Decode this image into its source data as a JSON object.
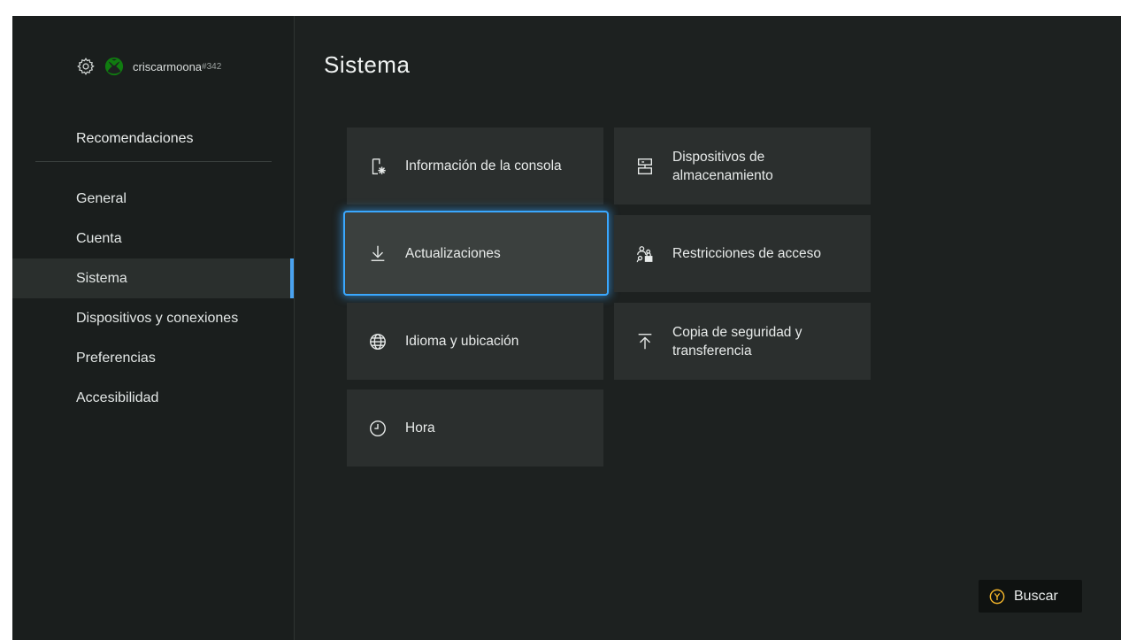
{
  "profile": {
    "gamertag": "criscarmoona",
    "gamertag_suffix": "#342",
    "icons": [
      "gear-icon",
      "xbox-logo-icon"
    ]
  },
  "sidebar": {
    "recommendations_label": "Recomendaciones",
    "items": [
      {
        "label": "General"
      },
      {
        "label": "Cuenta"
      },
      {
        "label": "Sistema",
        "selected": true
      },
      {
        "label": "Dispositivos y conexiones"
      },
      {
        "label": "Preferencias"
      },
      {
        "label": "Accesibilidad"
      }
    ]
  },
  "main": {
    "title": "Sistema",
    "tiles": [
      {
        "label": "Información de la consola",
        "icon": "console-info-icon"
      },
      {
        "label": "Dispositivos de almacenamiento",
        "icon": "storage-icon"
      },
      {
        "label": "Actualizaciones",
        "icon": "download-icon",
        "focused": true
      },
      {
        "label": "Restricciones de acceso",
        "icon": "access-restrictions-icon"
      },
      {
        "label": "Idioma y ubicación",
        "icon": "globe-icon"
      },
      {
        "label": "Copia de seguridad y transferencia",
        "icon": "upload-icon"
      },
      {
        "label": "Hora",
        "icon": "clock-icon"
      }
    ]
  },
  "footer": {
    "search_button": {
      "label": "Buscar",
      "hint": "Y",
      "icon": "y-button-icon"
    }
  },
  "colors": {
    "background": "#1d2120",
    "tile": "#2b2f2e",
    "focus_accent": "#3aa8ff",
    "selected_indicator": "#4aa3f0"
  }
}
